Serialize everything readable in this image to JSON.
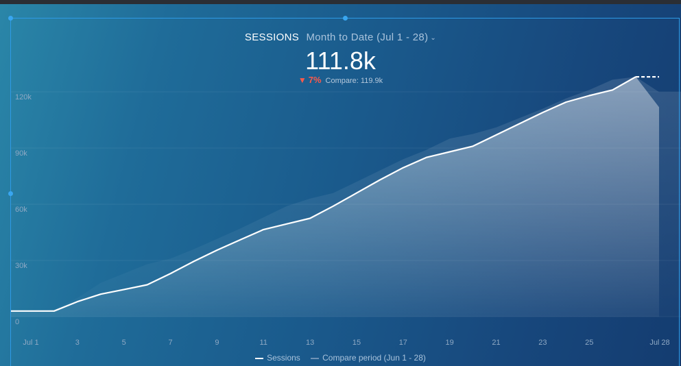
{
  "header": {
    "metric": "SESSIONS",
    "period": "Month to Date (Jul 1 - 28)",
    "value": "111.8k",
    "change_pct": "7%",
    "compare_label": "Compare: 119.9k"
  },
  "legend": {
    "current": "Sessions",
    "compare": "Compare period (Jun 1 - 28)"
  },
  "colors": {
    "current_line": "#ffffff",
    "down": "#ff5a4a",
    "selection": "#2e9be6"
  },
  "chart_data": {
    "type": "area",
    "title": "SESSIONS",
    "ylim": [
      0,
      120000
    ],
    "y_ticks": [
      0,
      30000,
      60000,
      90000,
      120000
    ],
    "y_tick_labels": [
      "0",
      "30k",
      "60k",
      "90k",
      "120k"
    ],
    "x_tick_days": [
      1,
      3,
      5,
      7,
      9,
      11,
      13,
      15,
      17,
      19,
      21,
      23,
      25,
      28
    ],
    "x_tick_labels": [
      "Jul 1",
      "3",
      "5",
      "7",
      "9",
      "11",
      "13",
      "15",
      "17",
      "19",
      "21",
      "23",
      "25",
      "Jul 28"
    ],
    "grid": true,
    "series": [
      {
        "name": "Sessions",
        "x": [
          1,
          2,
          3,
          4,
          5,
          6,
          7,
          8,
          9,
          10,
          11,
          12,
          13,
          14,
          15,
          16,
          17,
          18,
          19,
          20,
          21,
          22,
          23,
          24,
          25,
          26,
          27,
          28
        ],
        "values": [
          3000,
          3000,
          8000,
          12000,
          14500,
          17000,
          23000,
          29500,
          35500,
          41000,
          46500,
          49500,
          52500,
          59000,
          66000,
          73000,
          79500,
          85000,
          88000,
          91000,
          97000,
          103000,
          109000,
          114500,
          118000,
          121000,
          128000,
          111800
        ]
      },
      {
        "name": "Compare period (Jun 1 - 28)",
        "x": [
          1,
          2,
          3,
          4,
          5,
          6,
          7,
          8,
          9,
          10,
          11,
          12,
          13,
          14,
          15,
          16,
          17,
          18,
          19,
          20,
          21,
          22,
          23,
          24,
          25,
          26,
          27,
          28
        ],
        "values": [
          3000,
          4000,
          10000,
          18000,
          23000,
          28000,
          31000,
          36000,
          41500,
          47000,
          53000,
          59000,
          63000,
          66000,
          72000,
          78000,
          84000,
          89000,
          95000,
          97500,
          101000,
          106000,
          111000,
          116500,
          121000,
          126500,
          128000,
          119900
        ]
      }
    ]
  }
}
